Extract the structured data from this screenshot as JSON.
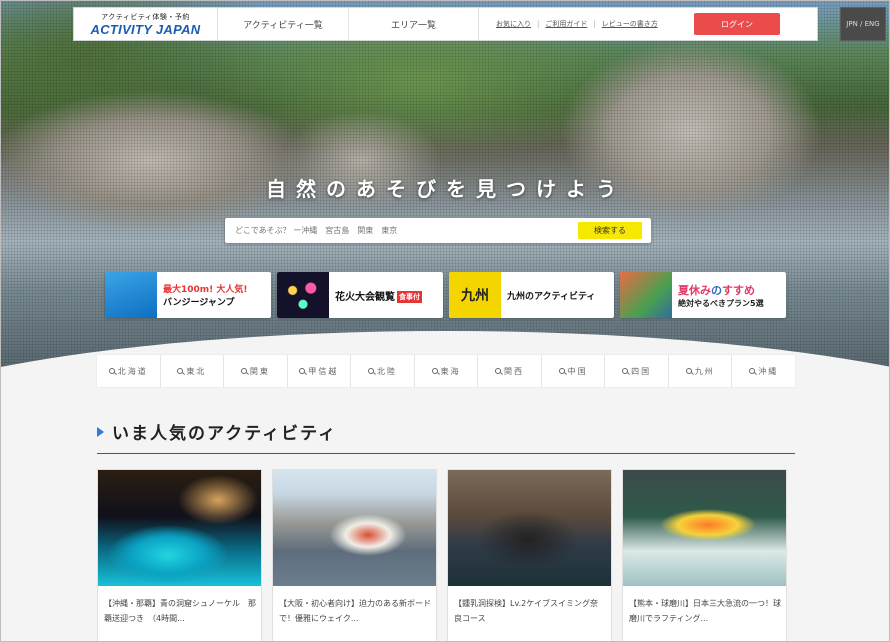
{
  "header": {
    "logo_sub": "アクティビティ体験・予約",
    "logo_main": "ACTIVITY JAPAN",
    "nav": [
      "アクティビティ一覧",
      "エリア一覧"
    ],
    "links": [
      "お気に入り",
      "ご利用ガイド",
      "レビューの書き方"
    ],
    "login": "ログイン",
    "lang": "JPN / ENG"
  },
  "hero": {
    "tagline": "自然のあそびを見つけよう",
    "search_placeholder": "どこであそぶ？ ー沖縄　宮古島　関東　東京",
    "search_button": "検索する"
  },
  "banners": [
    {
      "title": "最大100m! 大人気!",
      "subtitle": "バンジージャンプ"
    },
    {
      "title": "花火大会観覧",
      "badge": "食事付"
    },
    {
      "thumb": "九州",
      "title": "九州のアクティビティ"
    },
    {
      "title_a": "夏休み",
      "title_b": "の",
      "title_c": "すすめ",
      "subtitle": "絶対やるべきプラン5選"
    }
  ],
  "regions": [
    "北海道",
    "東北",
    "関東",
    "甲信越",
    "北陸",
    "東海",
    "関西",
    "中国",
    "四国",
    "九州",
    "沖縄"
  ],
  "popular": {
    "title": "いま人気のアクティビティ",
    "cards": [
      {
        "text": "【沖縄・那覇】青の洞窟シュノーケル　那覇送迎つき　（4時間..."
      },
      {
        "text": "【大阪・初心者向け】迫力のある新ボードで！優雅にウェイク..."
      },
      {
        "text": "【鍾乳洞探検】Lv.2ケイブスイミング奈良コース"
      },
      {
        "text": "【熊本・球磨川】日本三大急流の一つ！球磨川でラフティング..."
      }
    ]
  },
  "colors": {
    "login": "#ec4b4b",
    "search_button": "#f6e800",
    "accent": "#2e7be0",
    "banner_red": "#e63535"
  }
}
